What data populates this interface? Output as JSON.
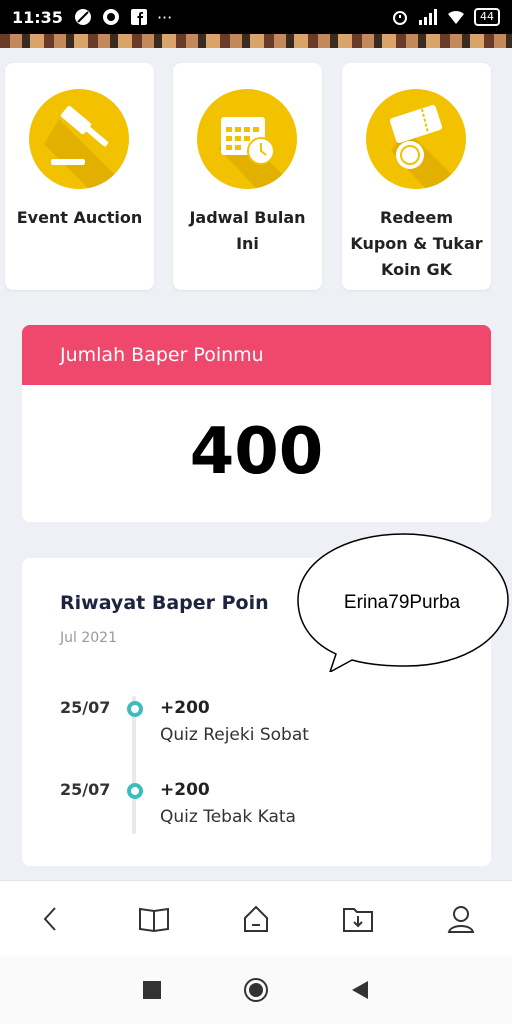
{
  "status_bar": {
    "time": "11:35",
    "battery": "44",
    "more": "···"
  },
  "menu_cards": [
    {
      "label": "Event Auction",
      "icon": "gavel-icon"
    },
    {
      "label": "Jadwal Bulan Ini",
      "icon": "calendar-clock-icon"
    },
    {
      "label": "Redeem Kupon & Tukar Koin GK",
      "icon": "coupon-coin-icon"
    }
  ],
  "points": {
    "header": "Jumlah Baper Poinmu",
    "value": "400"
  },
  "history": {
    "title": "Riwayat Baper Poin",
    "month": "Jul 2021",
    "entries": [
      {
        "date": "25/07",
        "amount": "+200",
        "desc": "Quiz Rejeki Sobat"
      },
      {
        "date": "25/07",
        "amount": "+200",
        "desc": "Quiz Tebak Kata"
      }
    ]
  },
  "annotation": {
    "text": "Erina79Purba"
  },
  "colors": {
    "accent": "#f0476d",
    "icon_circle": "#f2c200",
    "timeline_dot": "#3bbdc0"
  }
}
